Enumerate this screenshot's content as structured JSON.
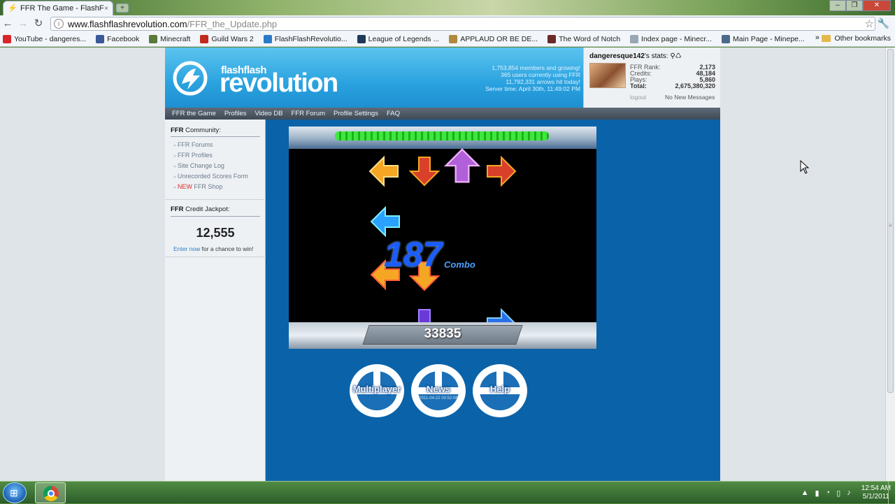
{
  "browser": {
    "tab_title": "FFR The Game - FlashFlas...",
    "tab_close": "×",
    "new_tab": "+",
    "url_host": "www.flashflashrevolution.com",
    "url_path": "/FFR_the_Update.php",
    "bookmarks": [
      {
        "label": "YouTube - dangeres...",
        "icon": "youtube-icon",
        "color": "#d8262b"
      },
      {
        "label": "Facebook",
        "icon": "facebook-icon",
        "color": "#3b5998"
      },
      {
        "label": "Minecraft",
        "icon": "minecraft-icon",
        "color": "#5a7a3a"
      },
      {
        "label": "Guild Wars 2",
        "icon": "guildwars-icon",
        "color": "#c22a1e"
      },
      {
        "label": "FlashFlashRevolutio...",
        "icon": "ffr-icon",
        "color": "#2a7ac8"
      },
      {
        "label": "League of Legends ...",
        "icon": "lol-icon",
        "color": "#1e3a5a"
      },
      {
        "label": "APPLAUD OR BE DE...",
        "icon": "applaud-icon",
        "color": "#b08a3a"
      },
      {
        "label": "The Word of Notch",
        "icon": "notch-icon",
        "color": "#6a2a2a"
      },
      {
        "label": "Index page - Minecr...",
        "icon": "page-icon",
        "color": "#9aa6b2"
      },
      {
        "label": "Main Page - Minepe...",
        "icon": "minepedia-icon",
        "color": "#4a6a8a"
      }
    ],
    "chevron": "»",
    "other_bookmarks": "Other bookmarks"
  },
  "site": {
    "logo_small": "flashflash",
    "logo_big": "revolution",
    "stats_lines": [
      "1,753,854 members and growing!",
      "365 users currently using FFR",
      "11,792,331 arrows hit today!",
      "Server time: April 30th, 11:49:02 PM"
    ],
    "user": {
      "name": "dangeresque142",
      "name_suffix": "'s stats:",
      "stats": [
        {
          "label": "FFR Rank:",
          "value": "2,173"
        },
        {
          "label": "Credits:",
          "value": "48,184"
        },
        {
          "label": "Plays:",
          "value": "5,860"
        },
        {
          "label": "Total:",
          "value": "2,675,380,320"
        }
      ],
      "logout": "logout",
      "messages": "No New Messages"
    },
    "nav": [
      "FFR the Game",
      "Profiles",
      "Video DB",
      "FFR Forum",
      "Profile Settings",
      "FAQ"
    ],
    "sidebar": {
      "community_prefix": "FFR",
      "community_title": " Community:",
      "links": [
        "FFR Forums",
        "FFR Profiles",
        "Site Change Log",
        "Unrecorded Scores Form"
      ],
      "shop_new": "NEW",
      "shop_label": " FFR Shop",
      "jackpot_prefix": "FFR",
      "jackpot_title": " Credit Jackpot:",
      "jackpot_value": "12,555",
      "enter_link": "Enter now",
      "enter_suffix": " for a chance to win!"
    },
    "game": {
      "combo": "187",
      "combo_label": "Combo",
      "score": "33835",
      "life": 1.0
    },
    "menu_buttons": [
      {
        "label": "Multiplayer",
        "sub": ""
      },
      {
        "label": "News",
        "sub": "2011-04-22 00:52:08"
      },
      {
        "label": "Help",
        "sub": ""
      }
    ]
  },
  "taskbar": {
    "time": "12:54 AM",
    "date": "5/1/2011"
  }
}
